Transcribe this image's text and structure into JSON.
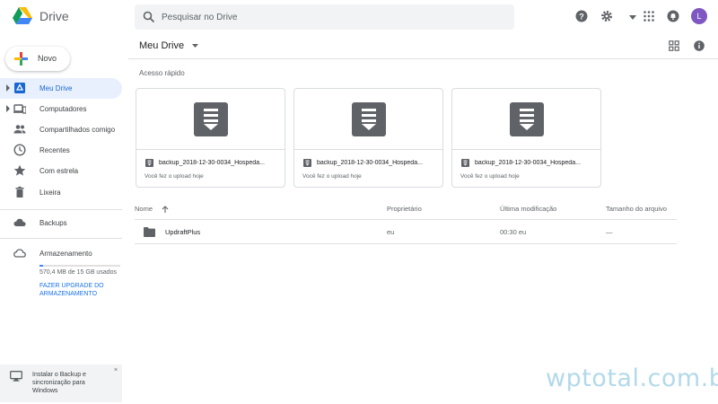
{
  "header": {
    "app_title": "Drive",
    "search_placeholder": "Pesquisar no Drive",
    "avatar_initial": "L"
  },
  "sidebar": {
    "new_label": "Novo",
    "items": [
      {
        "label": "Meu Drive",
        "icon": "drive-icon",
        "active": true
      },
      {
        "label": "Computadores",
        "icon": "computer-icon"
      },
      {
        "label": "Compartilhados comigo",
        "icon": "people-icon"
      },
      {
        "label": "Recentes",
        "icon": "clock-icon"
      },
      {
        "label": "Com estrela",
        "icon": "star-icon"
      },
      {
        "label": "Lixeira",
        "icon": "trash-icon"
      },
      {
        "label": "Backups",
        "icon": "cloud-icon"
      },
      {
        "label": "Armazenamento",
        "icon": "cloud-outline-icon"
      }
    ],
    "storage_used_fraction": 0.04,
    "storage_text": "570,4 MB de 15 GB usados",
    "upgrade_label": "FAZER UPGRADE DO ARMAZENAMENTO",
    "promo_text": "Instalar o Backup e sincronização para Windows",
    "promo_close": "×"
  },
  "main": {
    "breadcrumb": "Meu Drive",
    "quick_access_title": "Acesso rápido",
    "quick_access": [
      {
        "name": "backup_2018-12-30-0034_Hospeda...",
        "sub": "Você fez o upload hoje"
      },
      {
        "name": "backup_2018-12-30-0034_Hospeda...",
        "sub": "Você fez o upload hoje"
      },
      {
        "name": "backup_2018-12-30-0034_Hospeda...",
        "sub": "Você fez o upload hoje"
      }
    ],
    "columns": {
      "name": "Nome",
      "owner": "Proprietário",
      "modified": "Última modificação",
      "size": "Tamanho do arquivo"
    },
    "rows": [
      {
        "name": "UpdraftPlus",
        "owner": "eu",
        "modified": "00:30 eu",
        "size": "—"
      }
    ]
  },
  "watermark": "wptotal.com.br",
  "colors": {
    "accent": "#1a73e8",
    "active_bg": "#e8f0fe",
    "icon_gray": "#5f6368",
    "avatar": "#7e57c2"
  }
}
